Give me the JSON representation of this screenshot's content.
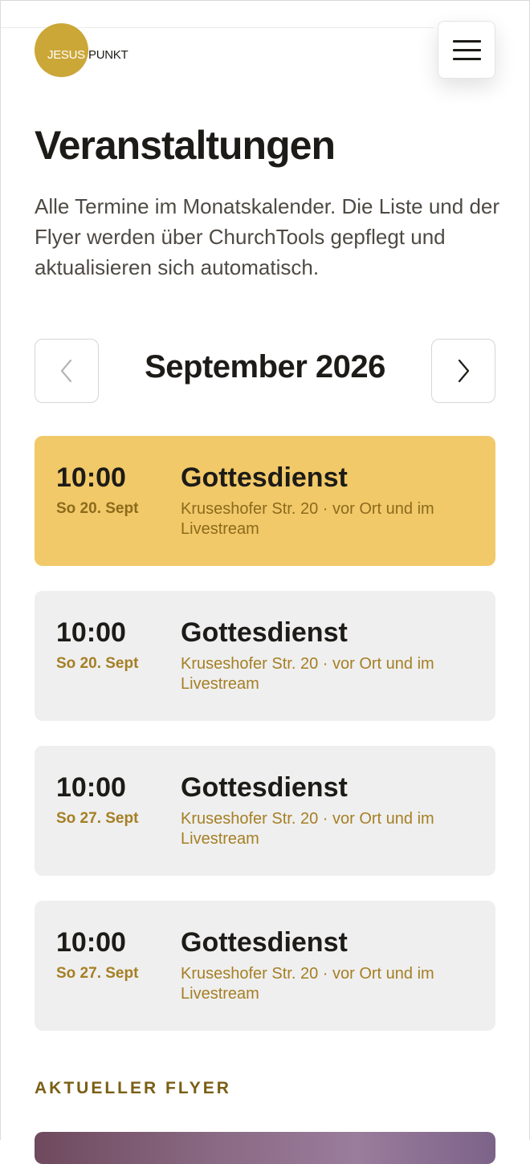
{
  "header": {
    "logo": {
      "word1": "JESUS",
      "word2": "PUNKT",
      "brand_color": "#cba738"
    },
    "menu_icon": "hamburger-icon"
  },
  "page": {
    "title": "Veranstaltungen",
    "intro": "Alle Termine im Monatskalender. Die Liste und der Flyer werden über ChurchTools gepflegt und aktualisieren sich automatisch."
  },
  "calendar": {
    "month_label": "September 2026",
    "prev_icon": "chevron-left-icon",
    "next_icon": "chevron-right-icon"
  },
  "events": [
    {
      "time": "10:00",
      "date": "So 20. Sept",
      "title": "Gottesdienst",
      "location": "Kruseshofer Str. 20 · vor Ort und im Livestream",
      "highlighted": true
    },
    {
      "time": "10:00",
      "date": "So 20. Sept",
      "title": "Gottesdienst",
      "location": "Kruseshofer Str. 20 · vor Ort und im Livestream",
      "highlighted": false
    },
    {
      "time": "10:00",
      "date": "So 27. Sept",
      "title": "Gottesdienst",
      "location": "Kruseshofer Str. 20 · vor Ort und im Livestream",
      "highlighted": false
    },
    {
      "time": "10:00",
      "date": "So 27. Sept",
      "title": "Gottesdienst",
      "location": "Kruseshofer Str. 20 · vor Ort und im Livestream",
      "highlighted": false
    }
  ],
  "flyer": {
    "heading": "AKTUELLER FLYER"
  },
  "colors": {
    "accent": "#f1c969",
    "card": "#efefef",
    "gold_text": "#a57f24"
  }
}
